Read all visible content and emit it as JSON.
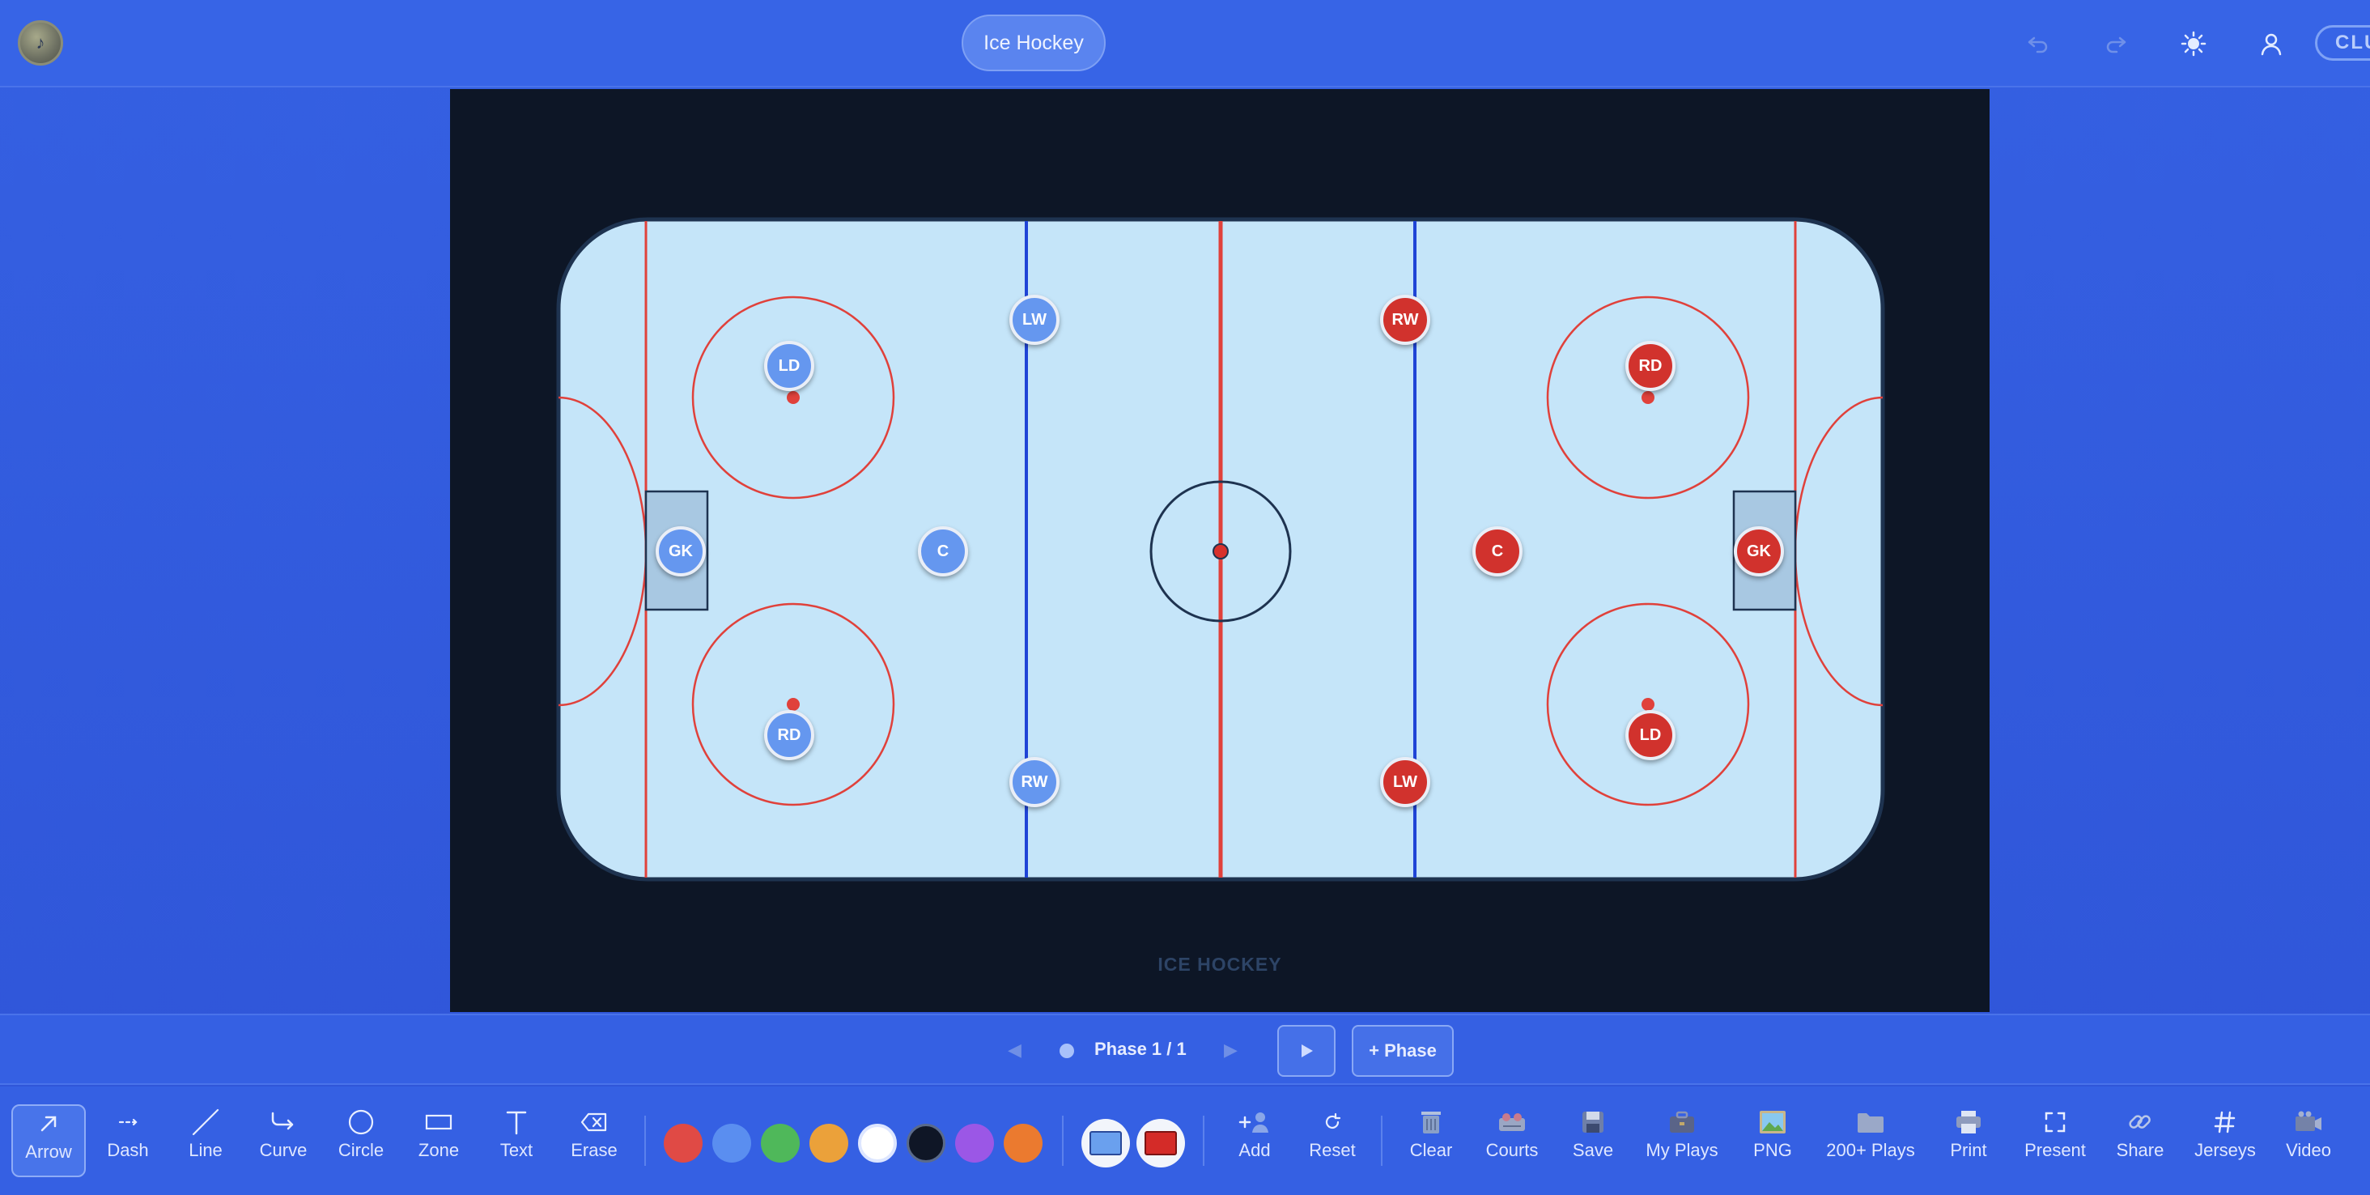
{
  "header": {
    "sport_label": "Ice Hockey",
    "club_label": "CLU",
    "icons": [
      "undo-icon",
      "redo-icon",
      "theme-sun-icon",
      "user-icon"
    ]
  },
  "rink": {
    "caption": "ICE HOCKEY",
    "colors": {
      "ice": "#c5e5f9",
      "boards": "#1e3350",
      "red_line": "#e0413b",
      "blue_line": "#1f44d6",
      "background": "#0d1626"
    }
  },
  "players": {
    "blue_team": [
      {
        "label": "LW"
      },
      {
        "label": "LD"
      },
      {
        "label": "GK"
      },
      {
        "label": "C"
      },
      {
        "label": "RD"
      },
      {
        "label": "RW"
      }
    ],
    "red_team": [
      {
        "label": "RW"
      },
      {
        "label": "RD"
      },
      {
        "label": "C"
      },
      {
        "label": "GK"
      },
      {
        "label": "LD"
      },
      {
        "label": "LW"
      }
    ],
    "colors": {
      "blue": "#6597ef",
      "red": "#d1322d"
    }
  },
  "phase": {
    "label": "Phase 1 / 1",
    "prev_icon": "chevron-left-icon",
    "next_icon": "chevron-right-icon",
    "play_icon": "play-icon",
    "add_label": "+ Phase"
  },
  "toolbar": {
    "draw_tools": [
      {
        "label": "Arrow",
        "icon": "arrow-icon",
        "active": true
      },
      {
        "label": "Dash",
        "icon": "dash-icon"
      },
      {
        "label": "Line",
        "icon": "line-icon"
      },
      {
        "label": "Curve",
        "icon": "curve-icon"
      },
      {
        "label": "Circle",
        "icon": "circle-icon"
      },
      {
        "label": "Zone",
        "icon": "zone-icon"
      },
      {
        "label": "Text",
        "icon": "text-icon"
      },
      {
        "label": "Erase",
        "icon": "erase-icon"
      }
    ],
    "colors": [
      "#e04a45",
      "#5a8ef0",
      "#4fb85a",
      "#eba13a",
      "#ffffff",
      "#0f1626",
      "#9b57e6",
      "#eb7a2f"
    ],
    "selected_color": "#ffffff",
    "team_colors": [
      "#6aa0ee",
      "#d42b28"
    ],
    "actions": [
      {
        "label": "Add",
        "icon": "add-player-icon"
      },
      {
        "label": "Reset",
        "icon": "reset-icon"
      },
      {
        "label": "Clear",
        "icon": "trash-icon"
      },
      {
        "label": "Courts",
        "icon": "courts-icon"
      },
      {
        "label": "Save",
        "icon": "save-icon"
      },
      {
        "label": "My Plays",
        "icon": "briefcase-icon"
      },
      {
        "label": "PNG",
        "icon": "image-icon"
      },
      {
        "label": "200+ Plays",
        "icon": "folder-icon"
      },
      {
        "label": "Print",
        "icon": "printer-icon"
      },
      {
        "label": "Present",
        "icon": "fullscreen-icon"
      },
      {
        "label": "Share",
        "icon": "link-icon"
      },
      {
        "label": "Jerseys",
        "icon": "hash-icon"
      },
      {
        "label": "Video",
        "icon": "video-icon"
      }
    ]
  }
}
